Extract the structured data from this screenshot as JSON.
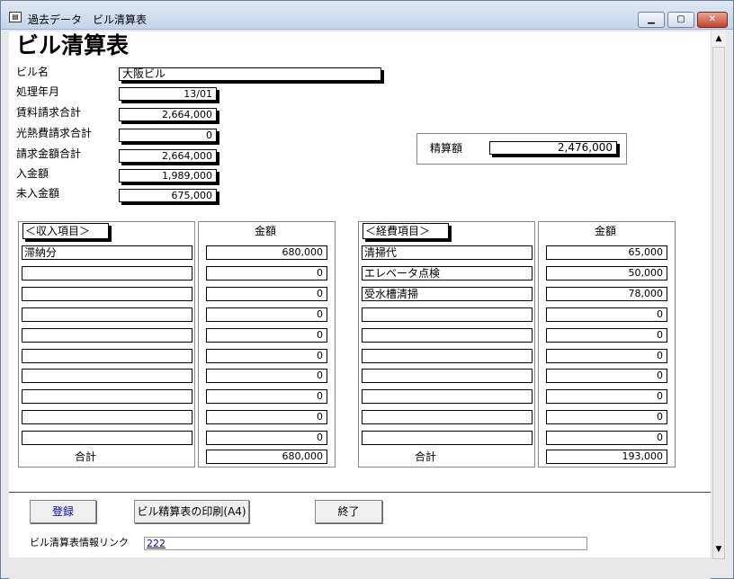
{
  "window": {
    "title": "過去データ　ビル清算表",
    "min_icon": "minimize-icon",
    "max_icon": "maximize-icon",
    "close_icon": "close-icon"
  },
  "form": {
    "heading": "ビル清算表",
    "building_label": "ビル名",
    "building_value": "大阪ビル",
    "period_label": "処理年月",
    "period_value": "13/01",
    "rent_label": "賃料請求合計",
    "rent_value": "2,664,000",
    "utility_label": "光熱費請求合計",
    "utility_value": "0",
    "billing_label": "請求金額合計",
    "billing_value": "2,664,000",
    "received_label": "入金額",
    "received_value": "1,989,000",
    "unpaid_label": "未入金額",
    "unpaid_value": "675,000",
    "net_label": "精算額",
    "net_value": "2,476,000"
  },
  "income": {
    "header": "＜収入項目＞",
    "amount_header": "金額",
    "rows": [
      {
        "item": "滞納分",
        "amount": "680,000"
      },
      {
        "item": "",
        "amount": "0"
      },
      {
        "item": "",
        "amount": "0"
      },
      {
        "item": "",
        "amount": "0"
      },
      {
        "item": "",
        "amount": "0"
      },
      {
        "item": "",
        "amount": "0"
      },
      {
        "item": "",
        "amount": "0"
      },
      {
        "item": "",
        "amount": "0"
      },
      {
        "item": "",
        "amount": "0"
      },
      {
        "item": "",
        "amount": "0"
      }
    ],
    "total_label": "合計",
    "total_value": "680,000"
  },
  "expense": {
    "header": "＜経費項目＞",
    "amount_header": "金額",
    "rows": [
      {
        "item": "清掃代",
        "amount": "65,000"
      },
      {
        "item": "エレベータ点検",
        "amount": "50,000"
      },
      {
        "item": "受水槽清掃",
        "amount": "78,000"
      },
      {
        "item": "",
        "amount": "0"
      },
      {
        "item": "",
        "amount": "0"
      },
      {
        "item": "",
        "amount": "0"
      },
      {
        "item": "",
        "amount": "0"
      },
      {
        "item": "",
        "amount": "0"
      },
      {
        "item": "",
        "amount": "0"
      },
      {
        "item": "",
        "amount": "0"
      }
    ],
    "total_label": "合計",
    "total_value": "193,000"
  },
  "footer": {
    "register_label": "登録",
    "print_label": "ビル精算表の印刷(A4)",
    "close_label": "終了",
    "link_label": "ビル清算表情報リンク",
    "link_value": "222"
  }
}
